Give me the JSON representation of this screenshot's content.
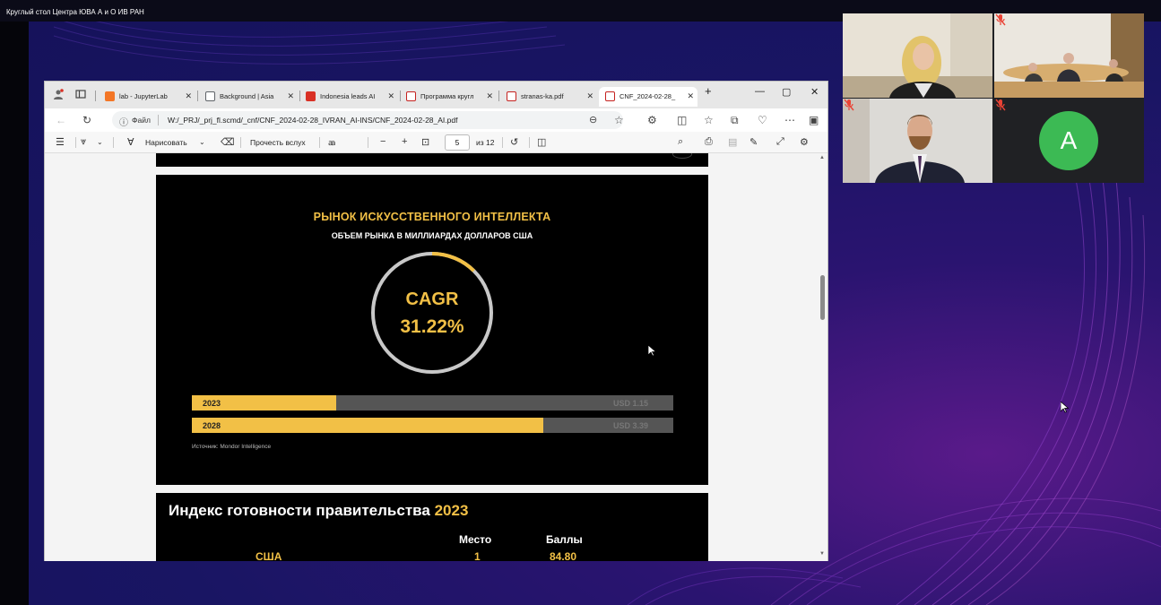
{
  "meeting": {
    "title": "Круглый стол Центра ЮВА А и О ИВ РАН"
  },
  "browser": {
    "tabs": [
      {
        "label": "lab - JupyterLab",
        "favicon_color": "#f37626"
      },
      {
        "label": "Background | Asia",
        "favicon_color": "#5f6368"
      },
      {
        "label": "Indonesia leads AI",
        "favicon_color": "#d93025"
      },
      {
        "label": "Программа кругл",
        "favicon_color": "#c5221f"
      },
      {
        "label": "stranas-ka.pdf",
        "favicon_color": "#c5221f"
      },
      {
        "label": "CNF_2024-02-28_",
        "favicon_color": "#c5221f",
        "active": true
      }
    ],
    "new_tab_glyph": "+",
    "window_controls": {
      "minimize": "—",
      "maximize": "▢",
      "close": "✕"
    },
    "address": {
      "file_label": "Файл",
      "url": "W:/_PRJ/_prj_fl.scmd/_cnf/CNF_2024-02-28_IVRAN_AI-INS/CNF_2024-02-28_AI.pdf"
    }
  },
  "pdf_toolbar": {
    "draw_label": "Нарисовать",
    "read_aloud_label": "Прочесть вслух",
    "text_size_label": "ꜳ",
    "zoom_out": "−",
    "zoom_in": "+",
    "page_current": "5",
    "page_total": "из 12"
  },
  "slide_market": {
    "title": "РЫНОК ИСКУССТВЕННОГО ИНТЕЛЛЕКТА",
    "subtitle": "ОБЪЕМ РЫНКА В МИЛЛИАРДАХ ДОЛЛАРОВ США",
    "cagr_label": "CAGR",
    "cagr_value": "31.22%",
    "cagr_fraction": 0.3122,
    "bars": [
      {
        "year": "2023",
        "value_label": "USD 1.15",
        "fill_fraction": 0.3
      },
      {
        "year": "2028",
        "value_label": "USD 3.39",
        "fill_fraction": 0.73
      }
    ],
    "source": "Источник: Mondor Intelligence",
    "colors": {
      "accent": "#f2c046",
      "track": "#555555",
      "ring": "#c8c8c8"
    }
  },
  "slide_index": {
    "title_prefix": "Индекс готовности правительства",
    "title_year": "2023",
    "col_place": "Место",
    "col_score": "Баллы",
    "rows": [
      {
        "country": "США",
        "place": "1",
        "score": "84.80"
      }
    ]
  },
  "participants": [
    {
      "id": "p1",
      "muted": false
    },
    {
      "id": "p2",
      "muted": true
    },
    {
      "id": "p3",
      "muted": true
    },
    {
      "id": "p4",
      "initial": "A",
      "muted": true,
      "avatar_color": "#3cba54"
    }
  ]
}
